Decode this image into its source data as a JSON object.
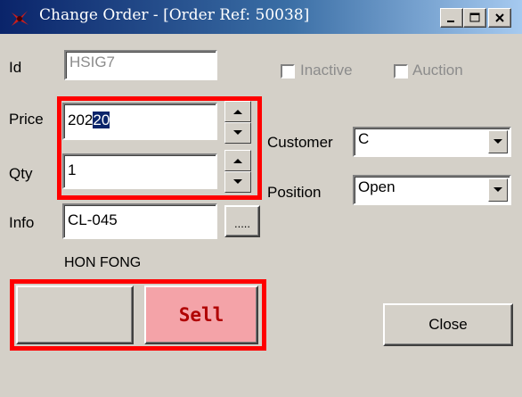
{
  "window": {
    "title": "Change Order - [Order Ref: 50038]"
  },
  "titlebar": {
    "minimize": "_",
    "maximize": "□",
    "close": "✕"
  },
  "form": {
    "id_label": "Id",
    "id_value": "HSIG7",
    "inactive_label": "Inactive",
    "auction_label": "Auction",
    "price_label": "Price",
    "price_value_plain": "202",
    "price_value_selected": "20",
    "qty_label": "Qty",
    "qty_value": "1",
    "info_label": "Info",
    "info_value": "CL-045",
    "info_button": ".....",
    "customer_label": "Customer",
    "customer_value": "C",
    "position_label": "Position",
    "position_value": "Open",
    "client_name": "HON FONG"
  },
  "actions": {
    "sell_label": "Sell",
    "close_label": "Close"
  },
  "colors": {
    "highlight": "#ff0000",
    "sell_bg": "#f4a3a8",
    "sell_text": "#b00000",
    "title_start": "#0a246a",
    "title_end": "#a6caf0"
  }
}
